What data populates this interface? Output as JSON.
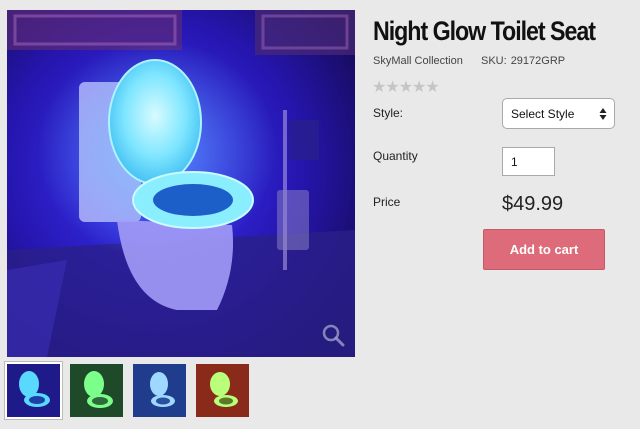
{
  "product": {
    "title": "Night Glow Toilet Seat",
    "collection": "SkyMall Collection",
    "sku_label": "SKU:",
    "sku_value": "29172GRP",
    "rating_stars": "★★★★★"
  },
  "options": {
    "style_label": "Style:",
    "style_selected": "Select Style",
    "quantity_label": "Quantity",
    "quantity_value": "1",
    "price_label": "Price",
    "price_value": "$49.99"
  },
  "actions": {
    "add_to_cart_label": "Add to cart"
  },
  "gallery": {
    "thumbnails": [
      {
        "name": "blue-glow",
        "glow": "#5ad9ff",
        "bg": "#1f1a8a"
      },
      {
        "name": "green-glow",
        "glow": "#7cff8a",
        "bg": "#1f4a2a"
      },
      {
        "name": "cool-blue-glow",
        "glow": "#9fd8ff",
        "bg": "#203c8c"
      },
      {
        "name": "red-room-green-glow",
        "glow": "#b9ff7a",
        "bg": "#8a2a1a"
      }
    ],
    "active_index": 0
  },
  "colors": {
    "button": "#dd6b79",
    "stars": "#c5c5c5",
    "background": "#e9e9e9"
  }
}
